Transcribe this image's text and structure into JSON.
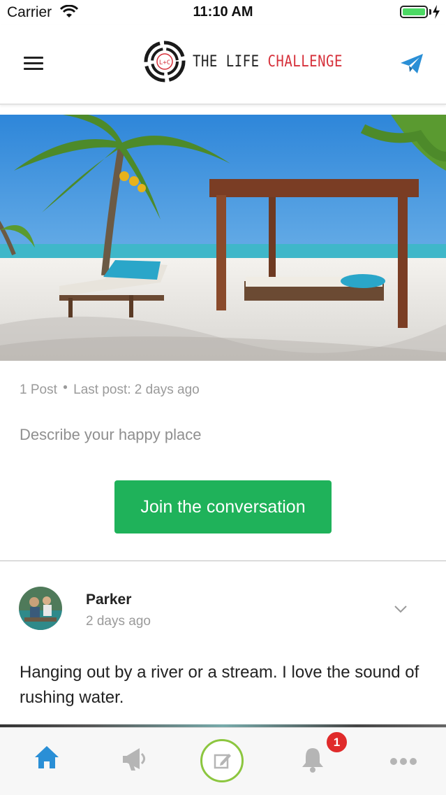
{
  "status_bar": {
    "carrier": "Carrier",
    "time": "11:10 AM"
  },
  "header": {
    "logo_mark": "L+C",
    "logo_word1": "THE LIFE",
    "logo_word2": "CHALLENGE"
  },
  "topic": {
    "post_count": "1 Post",
    "last_post": "Last post: 2 days ago",
    "description": "Describe your happy place",
    "join_label": "Join the conversation"
  },
  "post": {
    "author": "Parker",
    "time": "2 days ago",
    "body": "Hanging out by a river or a stream. I love the sound of rushing water."
  },
  "tab_bar": {
    "items": [
      "home-icon",
      "megaphone-icon",
      "compose-icon",
      "bell-icon",
      "more-icon"
    ],
    "notification_count": "1"
  },
  "colors": {
    "accent": "#1fb25a",
    "brand_red": "#d6303a",
    "tab_active": "#2a8fd6",
    "compose_ring": "#8cc63f",
    "badge": "#e02b2b"
  }
}
